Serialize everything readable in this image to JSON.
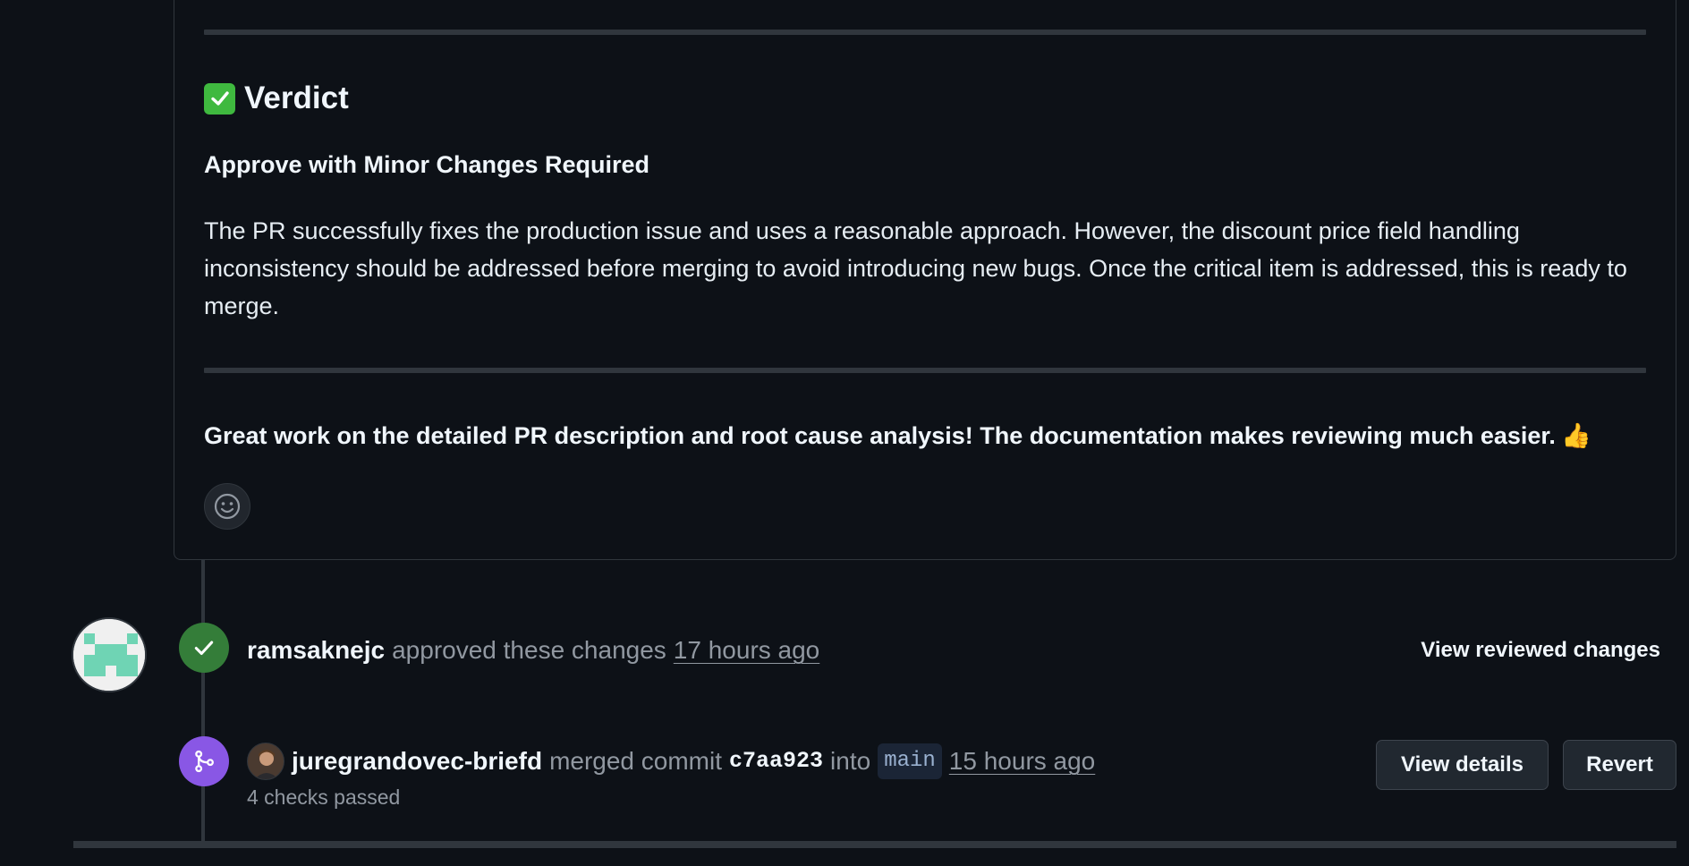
{
  "review": {
    "verdict_heading": "Verdict",
    "verdict_subheading": "Approve with Minor Changes Required",
    "verdict_body": "The PR successfully fixes the production issue and uses a reasonable approach. However, the discount price field handling inconsistency should be addressed before merging to avoid introducing new bugs. Once the critical item is addressed, this is ready to merge.",
    "closing_text": "Great work on the detailed PR description and root cause analysis! The documentation makes reviewing much easier.",
    "closing_emoji": "👍"
  },
  "timeline": {
    "approval": {
      "author": "ramsaknejc",
      "action": "approved these changes",
      "time": "17 hours ago",
      "view_link": "View reviewed changes"
    },
    "merge": {
      "author": "juregrandovec-briefd",
      "action": "merged commit",
      "commit": "c7aa923",
      "into": "into",
      "branch": "main",
      "time": "15 hours ago",
      "checks": "4 checks passed",
      "details_button": "View details",
      "revert_button": "Revert"
    }
  },
  "colors": {
    "background": "#0d1117",
    "approved_badge": "#347d39",
    "merged_badge": "#8957e5",
    "identicon": "#6fd4b4"
  },
  "icons": {
    "verdict": "check-mark-button-icon",
    "reaction": "smiley-icon",
    "approved": "check-icon",
    "merged": "git-merge-icon"
  }
}
